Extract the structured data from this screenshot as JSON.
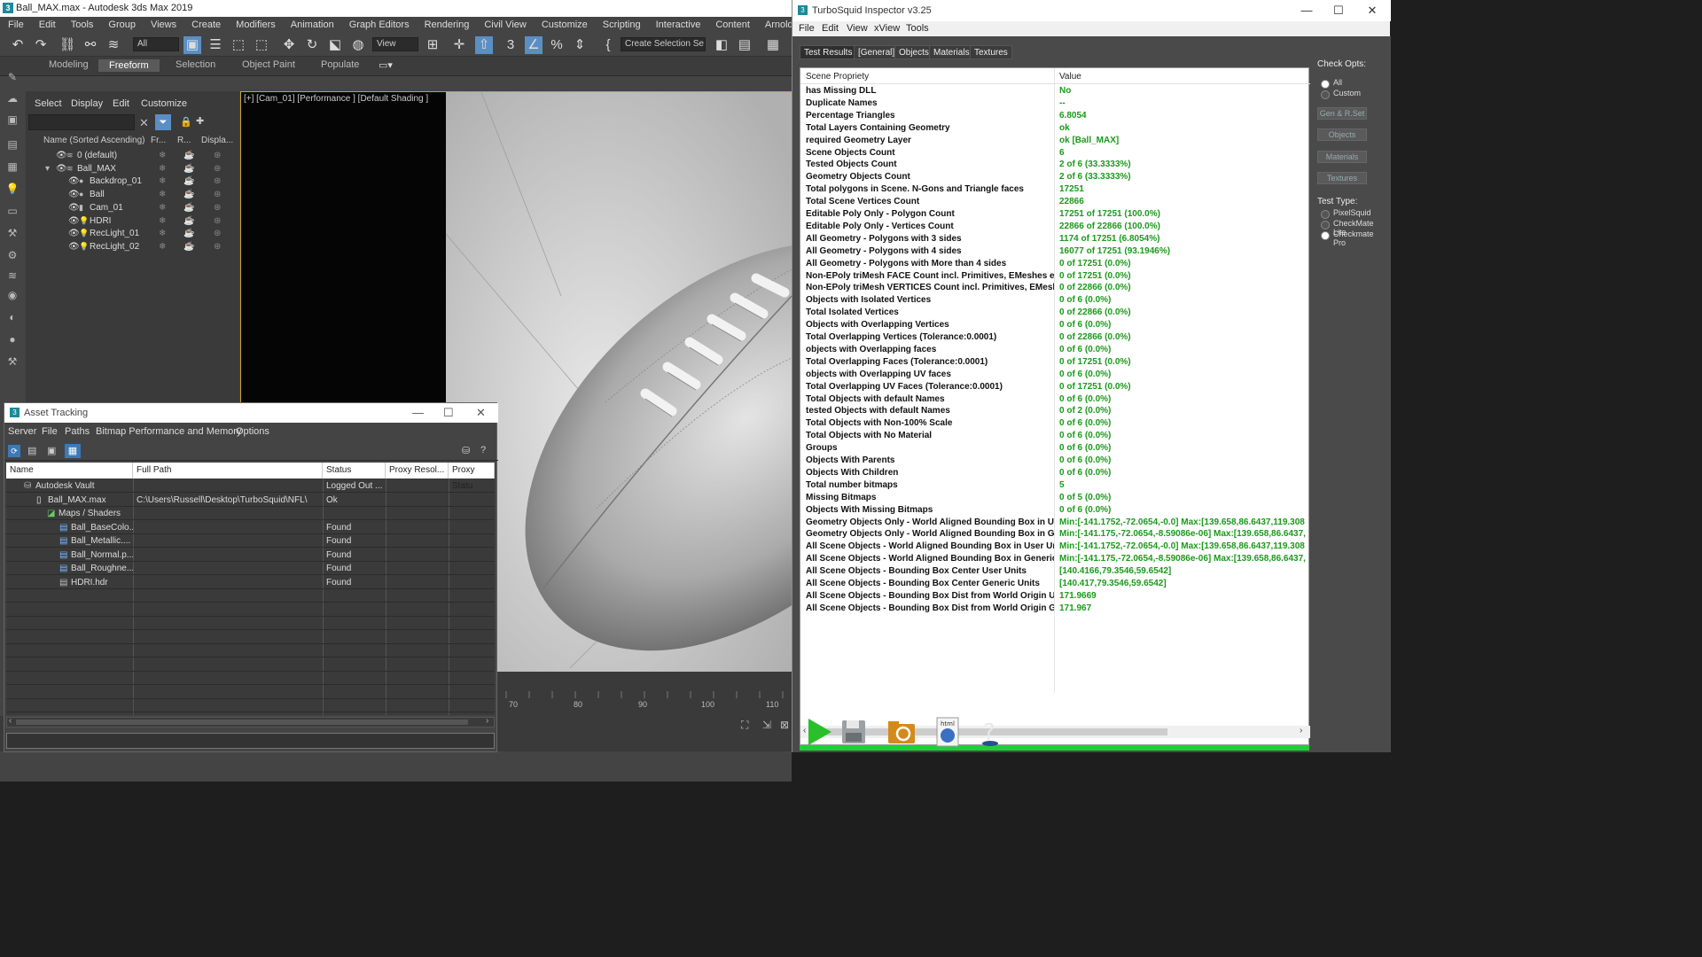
{
  "max": {
    "title": "Ball_MAX.max - Autodesk 3ds Max 2019",
    "menu": [
      "File",
      "Edit",
      "Tools",
      "Group",
      "Views",
      "Create",
      "Modifiers",
      "Animation",
      "Graph Editors",
      "Rendering",
      "Civil View",
      "Customize",
      "Scripting",
      "Interactive",
      "Content",
      "Arnold"
    ],
    "filter_select": "All",
    "view_select": "View",
    "selection_set": "Create Selection Se",
    "ribbon_tabs": [
      "Modeling",
      "Freeform",
      "Selection",
      "Object Paint",
      "Populate"
    ],
    "explorer": {
      "menu": [
        "Select",
        "Display",
        "Edit",
        "Customize"
      ],
      "columns": [
        "Name (Sorted Ascending)",
        "Fr...",
        "R...",
        "Displa..."
      ],
      "items": [
        "0 (default)",
        "Ball_MAX",
        "Backdrop_01",
        "Ball",
        "Cam_01",
        "HDRI",
        "RecLight_01",
        "RecLight_02"
      ]
    },
    "viewport_label": "[+] [Cam_01] [Performance ] [Default Shading ]",
    "timeline_ticks": [
      "70",
      "80",
      "90",
      "100",
      "110"
    ]
  },
  "asset_tracking": {
    "title": "Asset Tracking",
    "menu": [
      "Server",
      "File",
      "Paths",
      "Bitmap Performance and Memory",
      "Options"
    ],
    "columns": [
      "Name",
      "Full Path",
      "Status",
      "Proxy Resol...",
      "Proxy Statu"
    ],
    "rows": [
      {
        "name": "Autodesk Vault",
        "path": "",
        "status": "Logged Out ..."
      },
      {
        "name": "Ball_MAX.max",
        "path": "C:\\Users\\Russell\\Desktop\\TurboSquid\\NFL\\",
        "status": "Ok"
      },
      {
        "name": "Maps / Shaders",
        "path": "",
        "status": ""
      },
      {
        "name": "Ball_BaseColo...",
        "path": "",
        "status": "Found"
      },
      {
        "name": "Ball_Metallic....",
        "path": "",
        "status": "Found"
      },
      {
        "name": "Ball_Normal.p...",
        "path": "",
        "status": "Found"
      },
      {
        "name": "Ball_Roughne...",
        "path": "",
        "status": "Found"
      },
      {
        "name": "HDRI.hdr",
        "path": "",
        "status": "Found"
      }
    ]
  },
  "inspector": {
    "title": "TurboSquid Inspector v3.25",
    "menu": [
      "File",
      "Edit",
      "View",
      "xView",
      "Tools"
    ],
    "tabs": [
      "Test Results",
      "[General]",
      "Objects",
      "Materials",
      "Textures"
    ],
    "columns": [
      "Scene Propriety",
      "Value"
    ],
    "value_color": "#1a9a1a",
    "rows": [
      [
        "has Missing DLL",
        "No"
      ],
      [
        "Duplicate Names",
        "--"
      ],
      [
        "Percentage Triangles",
        "6.8054"
      ],
      [
        "Total Layers Containing Geometry",
        "ok"
      ],
      [
        "required Geometry Layer",
        "ok [Ball_MAX]"
      ],
      [
        "Scene Objects Count",
        "6"
      ],
      [
        "Tested Objects Count",
        "2 of 6 (33.3333%)"
      ],
      [
        "Geometry Objects Count",
        "2 of 6 (33.3333%)"
      ],
      [
        "Total polygons in Scene. N-Gons and Triangle faces",
        "17251"
      ],
      [
        "Total Scene Vertices Count",
        "22866"
      ],
      [
        "Editable Poly Only - Polygon Count",
        "17251 of 17251 (100.0%)"
      ],
      [
        "Editable Poly Only - Vertices Count",
        "22866 of 22866 (100.0%)"
      ],
      [
        "All Geometry - Polygons with 3 sides",
        "1174 of 17251 (6.8054%)"
      ],
      [
        "All Geometry - Polygons with 4 sides",
        "16077 of 17251 (93.1946%)"
      ],
      [
        "All Geometry - Polygons with More than 4 sides",
        "0 of 17251 (0.0%)"
      ],
      [
        "Non-EPoly triMesh FACE Count incl. Primitives, EMeshes etc...",
        "0 of 17251 (0.0%)"
      ],
      [
        "Non-EPoly triMesh VERTICES Count incl. Primitives, EMeshes ...",
        "0 of 22866 (0.0%)"
      ],
      [
        "Objects with Isolated Vertices",
        "0 of 6 (0.0%)"
      ],
      [
        "Total Isolated Vertices",
        "0 of 22866 (0.0%)"
      ],
      [
        "Objects with Overlapping Vertices",
        "0 of 6 (0.0%)"
      ],
      [
        "Total Overlapping Vertices (Tolerance:0.0001)",
        "0 of 22866 (0.0%)"
      ],
      [
        "objects with Overlapping faces",
        "0 of 6 (0.0%)"
      ],
      [
        "Total Overlapping Faces (Tolerance:0.0001)",
        "0 of 17251 (0.0%)"
      ],
      [
        "objects with Overlapping UV faces",
        "0 of 6 (0.0%)"
      ],
      [
        "Total Overlapping UV Faces (Tolerance:0.0001)",
        "0 of 17251 (0.0%)"
      ],
      [
        "Total Objects with default Names",
        "0 of 6 (0.0%)"
      ],
      [
        "tested Objects with default Names",
        "0 of 2 (0.0%)"
      ],
      [
        "Total Objects with Non-100% Scale",
        "0 of 6 (0.0%)"
      ],
      [
        "Total Objects with No Material",
        "0 of 6 (0.0%)"
      ],
      [
        "Groups",
        "0 of 6 (0.0%)"
      ],
      [
        "Objects With Parents",
        "0 of 6 (0.0%)"
      ],
      [
        "Objects With Children",
        "0 of 6 (0.0%)"
      ],
      [
        "Total number bitmaps",
        "5"
      ],
      [
        "Missing Bitmaps",
        "0 of 5 (0.0%)"
      ],
      [
        "Objects With Missing Bitmaps",
        "0 of 6 (0.0%)"
      ],
      [
        "Geometry Objects Only - World Aligned Bounding Box in User...",
        "Min:[-141.1752,-72.0654,-0.0]  Max:[139.658,86.6437,119.308"
      ],
      [
        "Geometry Objects Only - World Aligned Bounding Box in Gen...",
        "Min:[-141.175,-72.0654,-8.59086e-06]  Max:[139.658,86.6437,"
      ],
      [
        "All Scene Objects - World Aligned Bounding Box in User Units",
        "Min:[-141.1752,-72.0654,-0.0]  Max:[139.658,86.6437,119.308"
      ],
      [
        "All Scene Objects - World Aligned Bounding Box in Generic Un...",
        "Min:[-141.175,-72.0654,-8.59086e-06]  Max:[139.658,86.6437,"
      ],
      [
        "All Scene Objects - Bounding Box Center User Units",
        "[140.4166,79.3546,59.6542]"
      ],
      [
        "All Scene Objects - Bounding Box Center Generic Units",
        "[140.417,79.3546,59.6542]"
      ],
      [
        "All Scene Objects - Bounding Box Dist from World Origin User...",
        "171.9669"
      ],
      [
        "All Scene Objects - Bounding Box Dist from World Origin Gen...",
        "171.967"
      ]
    ],
    "check_opts_label": "Check Opts:",
    "check_opts": [
      "All",
      "Custom"
    ],
    "side_buttons": [
      "Gen & R.Set",
      "Objects",
      "Materials",
      "Textures"
    ],
    "test_type_label": "Test Type:",
    "test_types": [
      "PixelSquid",
      "CheckMate Lite",
      "Checkmate Pro"
    ]
  }
}
